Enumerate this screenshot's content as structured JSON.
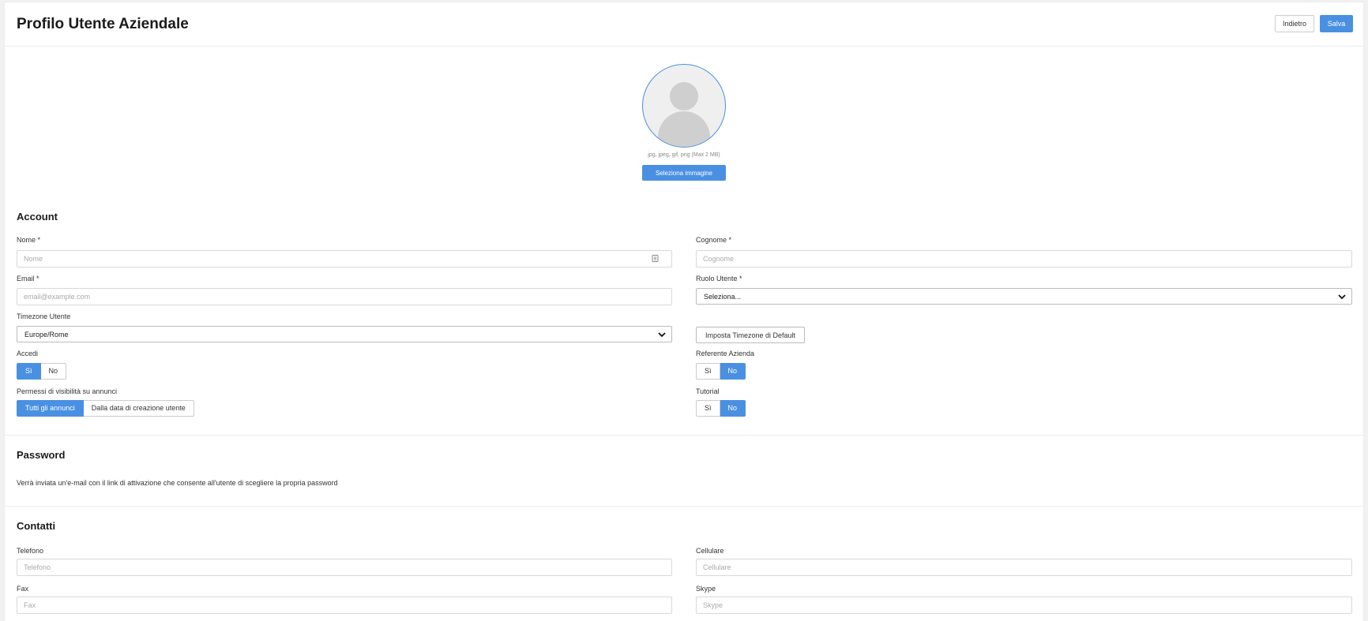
{
  "header": {
    "title": "Profilo Utente Aziendale",
    "back_label": "Indietro",
    "save_label": "Salva"
  },
  "avatar": {
    "hint": "jpg, jpeg, gif, png (Max 2 MB)",
    "select_label": "Seleziona immagine"
  },
  "account": {
    "title": "Account",
    "nome": {
      "label": "Nome *",
      "placeholder": "Nome"
    },
    "cognome": {
      "label": "Cognome *",
      "placeholder": "Cognome"
    },
    "email": {
      "label": "Email *",
      "placeholder": "email@example.com"
    },
    "ruolo": {
      "label": "Ruolo Utente *",
      "value": "Seleziona..."
    },
    "timezone": {
      "label": "Timezone Utente",
      "value": "Europe/Rome",
      "default_button": "Imposta Timezone di Default"
    },
    "accedi": {
      "label": "Accedi",
      "options": [
        "Sì",
        "No"
      ],
      "selected": "Sì"
    },
    "referente": {
      "label": "Referente Azienda",
      "options": [
        "Sì",
        "No"
      ],
      "selected": "No"
    },
    "permessi": {
      "label": "Permessi di visibilità su annunci",
      "options": [
        "Tutti gli annunci",
        "Dalla data di creazione utente"
      ],
      "selected": "Tutti gli annunci"
    },
    "tutorial": {
      "label": "Tutorial",
      "options": [
        "Sì",
        "No"
      ],
      "selected": "No"
    }
  },
  "password": {
    "title": "Password",
    "info": "Verrà inviata un'e-mail con il link di attivazione che consente all'utente di scegliere la propria password"
  },
  "contatti": {
    "title": "Contatti",
    "telefono": {
      "label": "Telefono",
      "placeholder": "Telefono"
    },
    "cellulare": {
      "label": "Cellulare",
      "placeholder": "Cellulare"
    },
    "fax": {
      "label": "Fax",
      "placeholder": "Fax"
    },
    "skype": {
      "label": "Skype",
      "placeholder": "Skype"
    }
  },
  "colors": {
    "accent": "#4a90e2"
  },
  "icons": {
    "chevron": "chevron-down-icon",
    "autofill": "contact-card-icon"
  }
}
